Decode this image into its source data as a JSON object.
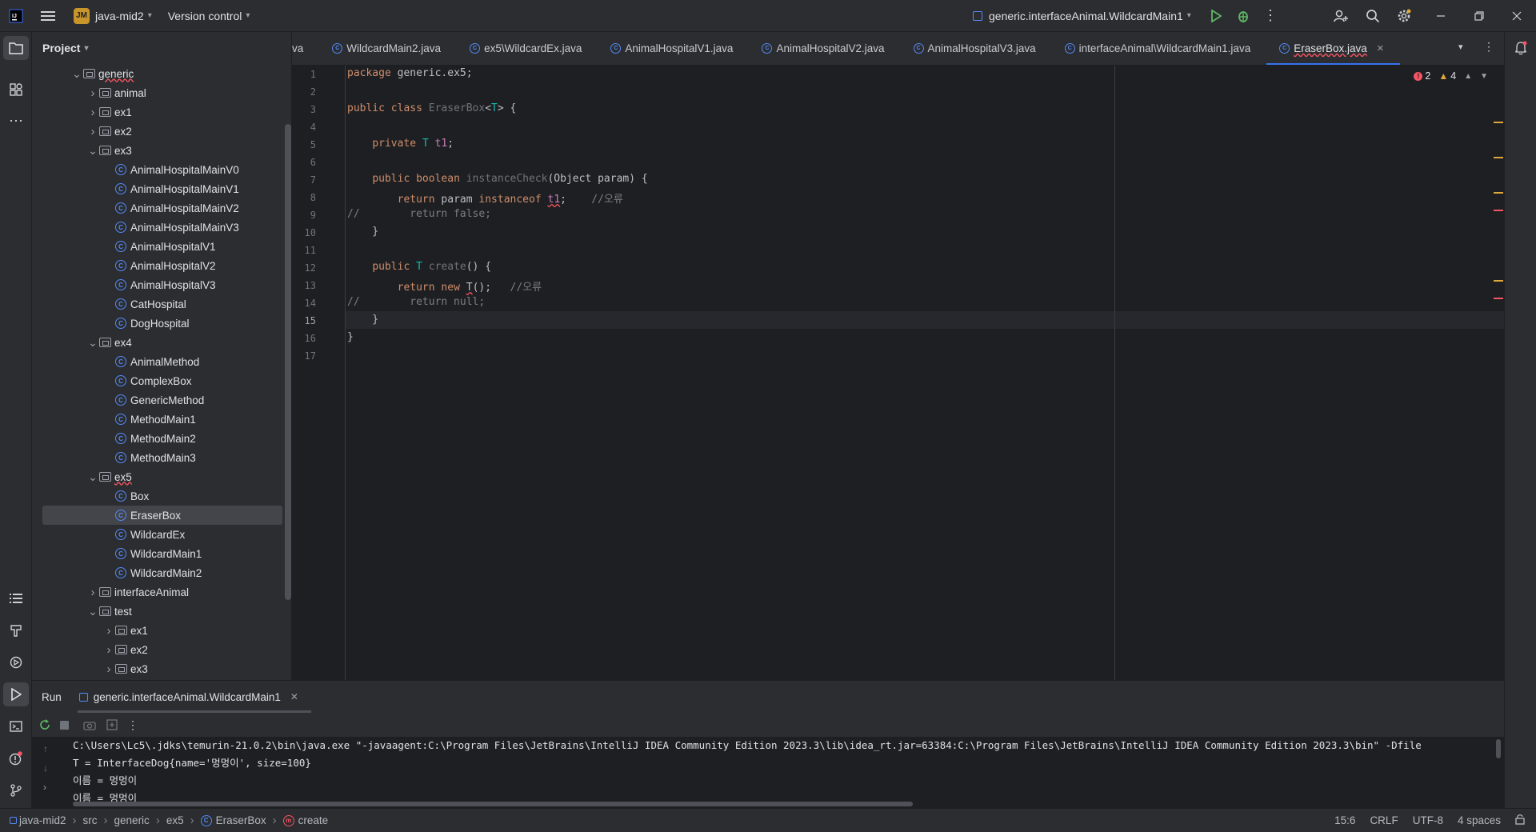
{
  "titlebar": {
    "project_badge": "JM",
    "project_name": "java-mid2",
    "vcs_label": "Version control",
    "run_config": "generic.interfaceAnimal.WildcardMain1"
  },
  "project_panel": {
    "title": "Project",
    "tree": [
      {
        "label": "generic",
        "kind": "folder",
        "level": 1,
        "expanded": true
      },
      {
        "label": "animal",
        "kind": "folder",
        "level": 2,
        "expanded": false
      },
      {
        "label": "ex1",
        "kind": "folder",
        "level": 2,
        "expanded": false
      },
      {
        "label": "ex2",
        "kind": "folder",
        "level": 2,
        "expanded": false
      },
      {
        "label": "ex3",
        "kind": "folder",
        "level": 2,
        "expanded": true
      },
      {
        "label": "AnimalHospitalMainV0",
        "kind": "class",
        "level": 3
      },
      {
        "label": "AnimalHospitalMainV1",
        "kind": "class",
        "level": 3
      },
      {
        "label": "AnimalHospitalMainV2",
        "kind": "class",
        "level": 3
      },
      {
        "label": "AnimalHospitalMainV3",
        "kind": "class",
        "level": 3
      },
      {
        "label": "AnimalHospitalV1",
        "kind": "class",
        "level": 3
      },
      {
        "label": "AnimalHospitalV2",
        "kind": "class",
        "level": 3
      },
      {
        "label": "AnimalHospitalV3",
        "kind": "class",
        "level": 3
      },
      {
        "label": "CatHospital",
        "kind": "class",
        "level": 3
      },
      {
        "label": "DogHospital",
        "kind": "class",
        "level": 3
      },
      {
        "label": "ex4",
        "kind": "folder",
        "level": 2,
        "expanded": true
      },
      {
        "label": "AnimalMethod",
        "kind": "class",
        "level": 3
      },
      {
        "label": "ComplexBox",
        "kind": "class",
        "level": 3
      },
      {
        "label": "GenericMethod",
        "kind": "class",
        "level": 3
      },
      {
        "label": "MethodMain1",
        "kind": "class",
        "level": 3
      },
      {
        "label": "MethodMain2",
        "kind": "class",
        "level": 3
      },
      {
        "label": "MethodMain3",
        "kind": "class",
        "level": 3
      },
      {
        "label": "ex5",
        "kind": "folder",
        "level": 2,
        "expanded": true
      },
      {
        "label": "Box",
        "kind": "class",
        "level": 3
      },
      {
        "label": "EraserBox",
        "kind": "class",
        "level": 3,
        "selected": true
      },
      {
        "label": "WildcardEx",
        "kind": "class",
        "level": 3
      },
      {
        "label": "WildcardMain1",
        "kind": "class",
        "level": 3
      },
      {
        "label": "WildcardMain2",
        "kind": "class",
        "level": 3
      },
      {
        "label": "interfaceAnimal",
        "kind": "folder",
        "level": 2,
        "expanded": false
      },
      {
        "label": "test",
        "kind": "folder",
        "level": 2,
        "expanded": true
      },
      {
        "label": "ex1",
        "kind": "folder",
        "level": 3,
        "expanded": false
      },
      {
        "label": "ex2",
        "kind": "folder",
        "level": 3,
        "expanded": false
      },
      {
        "label": "ex3",
        "kind": "folder",
        "level": 3,
        "expanded": false
      }
    ]
  },
  "tabs": [
    {
      "label": "va",
      "icon": false
    },
    {
      "label": "WildcardMain2.java",
      "icon": true
    },
    {
      "label": "ex5\\WildcardEx.java",
      "icon": true
    },
    {
      "label": "AnimalHospitalV1.java",
      "icon": true
    },
    {
      "label": "AnimalHospitalV2.java",
      "icon": true
    },
    {
      "label": "AnimalHospitalV3.java",
      "icon": true
    },
    {
      "label": "interfaceAnimal\\WildcardMain1.java",
      "icon": true
    },
    {
      "label": "EraserBox.java",
      "icon": true,
      "active": true
    }
  ],
  "editor": {
    "error_count": "2",
    "warning_count": "4",
    "current_line": "15",
    "lines": [
      "package generic.ex5;",
      "",
      "public class EraserBox<T> {",
      "",
      "    private T t1;",
      "",
      "    public boolean instanceCheck(Object param) {",
      "        return param instanceof t1;    //오류",
      "//        return false;",
      "    }",
      "",
      "    public T create() {",
      "        return new T();   //오류",
      "//        return null;",
      "    }",
      "}",
      ""
    ]
  },
  "run_panel": {
    "title": "Run",
    "config_tab": "generic.interfaceAnimal.WildcardMain1",
    "output": [
      "C:\\Users\\Lc5\\.jdks\\temurin-21.0.2\\bin\\java.exe \"-javaagent:C:\\Program Files\\JetBrains\\IntelliJ IDEA Community Edition 2023.3\\lib\\idea_rt.jar=63384:C:\\Program Files\\JetBrains\\IntelliJ IDEA Community Edition 2023.3\\bin\" -Dfile",
      "T = InterfaceDog{name='멍멍이', size=100}",
      "이름 = 멍멍이",
      "이름 = 멍멍이"
    ]
  },
  "statusbar": {
    "breadcrumbs": [
      "java-mid2",
      "src",
      "generic",
      "ex5",
      "EraserBox",
      "create"
    ],
    "position": "15:6",
    "line_sep": "CRLF",
    "encoding": "UTF-8",
    "indent": "4 spaces"
  },
  "colors": {
    "accent": "#3574f0",
    "error": "#f75464",
    "warning": "#e0a83a",
    "run_green": "#5fb865"
  }
}
